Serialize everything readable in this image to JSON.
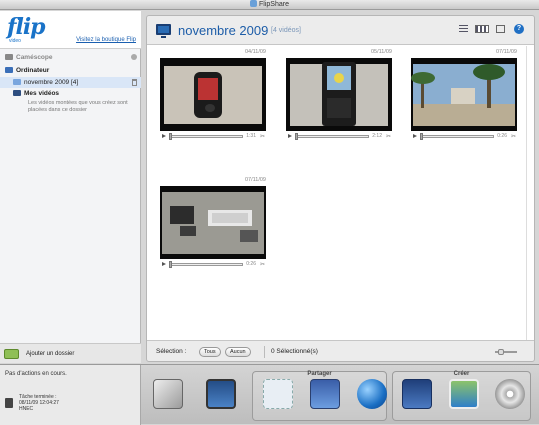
{
  "window": {
    "title": "FlipShare"
  },
  "sidebar": {
    "logo": "flip",
    "logo_sub": "video",
    "shop_link": "Visitez la boutique Flip",
    "camcorder": "Caméscope",
    "computer": "Ordinateur",
    "folder_name": "novembre 2009",
    "folder_count": "[4]",
    "my_videos": "Mes vidéos",
    "my_videos_note": "Les vidéos montées que vous créez sont placées dans ce dossier",
    "add_folder": "Ajouter un dossier"
  },
  "main": {
    "title": "novembre 2009",
    "count": "[4 vidéos]",
    "help": "?",
    "videos": [
      {
        "date": "04/11/09",
        "duration": "1:31"
      },
      {
        "date": "05/11/09",
        "duration": "2:12"
      },
      {
        "date": "07/11/09",
        "duration": "0:26"
      },
      {
        "date": "07/11/09",
        "duration": "0:26"
      }
    ],
    "selection_label": "Sélection :",
    "all_button": "Tous",
    "none_button": "Aucun",
    "selected_count": "0 Sélectionné(s)"
  },
  "status": {
    "message": "Pas d'actions en cours.",
    "task_title": "Tâche terminée :",
    "task_date": "08/11/09 12:04:27",
    "task_name": "HNEC"
  },
  "toolbar": {
    "share_label": "Partager",
    "create_label": "Créer"
  },
  "colors": {
    "accent": "#1d5da8",
    "logo": "#1a73c8"
  }
}
